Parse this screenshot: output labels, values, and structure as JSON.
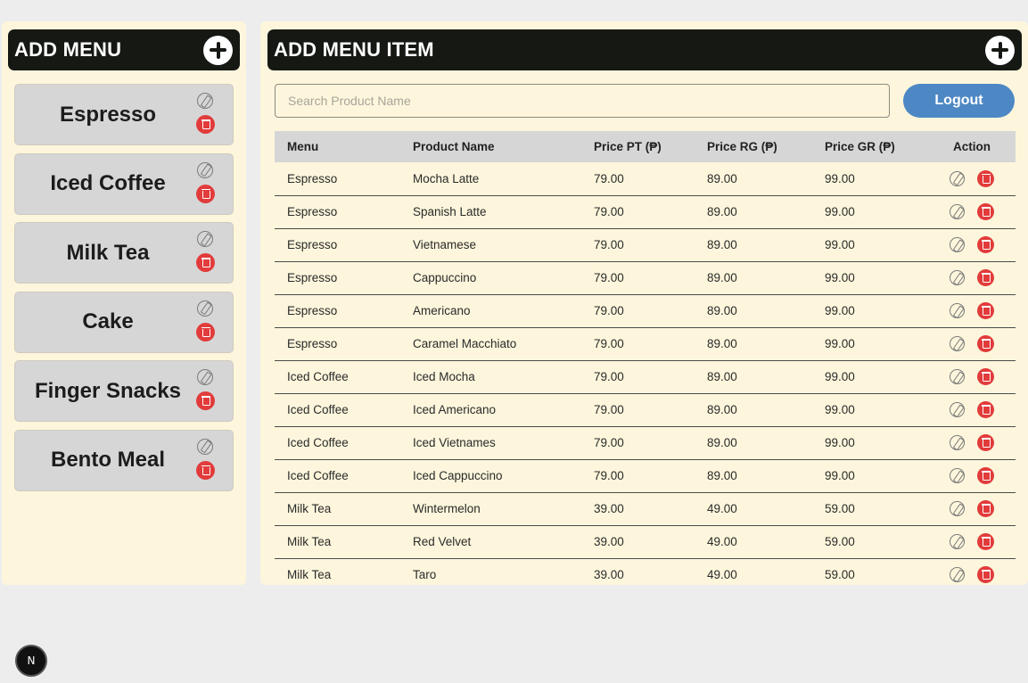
{
  "sidebar": {
    "title": "ADD MENU",
    "menus": [
      {
        "label": "Espresso"
      },
      {
        "label": "Iced Coffee"
      },
      {
        "label": "Milk Tea"
      },
      {
        "label": "Cake"
      },
      {
        "label": "Finger Snacks"
      },
      {
        "label": "Bento Meal"
      }
    ]
  },
  "main": {
    "title": "ADD MENU ITEM",
    "search": {
      "placeholder": "Search Product Name",
      "value": ""
    },
    "logout_label": "Logout",
    "table": {
      "headers": [
        "Menu",
        "Product Name",
        "Price PT (₱)",
        "Price RG (₱)",
        "Price GR (₱)",
        "Action"
      ],
      "rows": [
        [
          "Espresso",
          "Mocha Latte",
          "79.00",
          "89.00",
          "99.00"
        ],
        [
          "Espresso",
          "Spanish Latte",
          "79.00",
          "89.00",
          "99.00"
        ],
        [
          "Espresso",
          "Vietnamese",
          "79.00",
          "89.00",
          "99.00"
        ],
        [
          "Espresso",
          "Cappuccino",
          "79.00",
          "89.00",
          "99.00"
        ],
        [
          "Espresso",
          "Americano",
          "79.00",
          "89.00",
          "99.00"
        ],
        [
          "Espresso",
          "Caramel Macchiato",
          "79.00",
          "89.00",
          "99.00"
        ],
        [
          "Iced Coffee",
          "Iced Mocha",
          "79.00",
          "89.00",
          "99.00"
        ],
        [
          "Iced Coffee",
          "Iced Americano",
          "79.00",
          "89.00",
          "99.00"
        ],
        [
          "Iced Coffee",
          "Iced Vietnames",
          "79.00",
          "89.00",
          "99.00"
        ],
        [
          "Iced Coffee",
          "Iced Cappuccino",
          "79.00",
          "89.00",
          "99.00"
        ],
        [
          "Milk Tea",
          "Wintermelon",
          "39.00",
          "49.00",
          "59.00"
        ],
        [
          "Milk Tea",
          "Red Velvet",
          "39.00",
          "49.00",
          "59.00"
        ],
        [
          "Milk Tea",
          "Taro",
          "39.00",
          "49.00",
          "59.00"
        ]
      ]
    }
  },
  "dev_badge": {
    "label": "N"
  },
  "colors": {
    "panel_bg": "#fdf6dc",
    "header_bg": "#151813",
    "card_bg": "#d6d6d6",
    "logout_bg": "#4d88c4",
    "delete_red": "#e23b3b"
  },
  "icons": {
    "add": "plus-circle-icon",
    "edit": "pencil-circle-icon",
    "delete": "trash-circle-icon"
  }
}
